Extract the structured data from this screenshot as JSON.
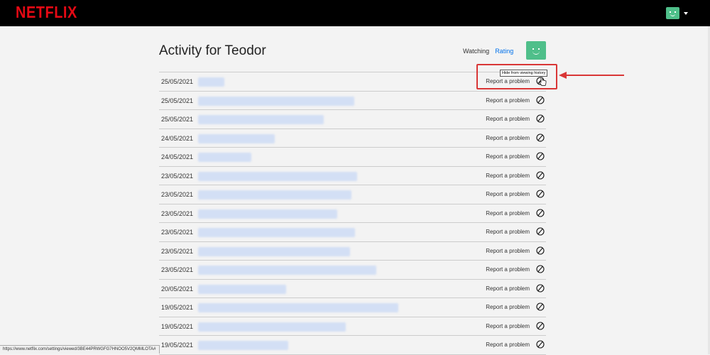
{
  "header": {
    "logo": "NETFLIX",
    "brand_color": "#e50914",
    "avatar_icon": "smiley-face-icon",
    "avatar_color": "#4fbf8a"
  },
  "page": {
    "title": "Activity for Teodor",
    "tabs": [
      {
        "label": "Watching",
        "active": true
      },
      {
        "label": "Rating",
        "active": false
      }
    ]
  },
  "tooltip": "Hide from viewing history",
  "report_label": "Report a problem",
  "rows": [
    {
      "date": "25/05/2021"
    },
    {
      "date": "25/05/2021"
    },
    {
      "date": "25/05/2021"
    },
    {
      "date": "24/05/2021"
    },
    {
      "date": "24/05/2021"
    },
    {
      "date": "23/05/2021"
    },
    {
      "date": "23/05/2021"
    },
    {
      "date": "23/05/2021"
    },
    {
      "date": "23/05/2021"
    },
    {
      "date": "23/05/2021"
    },
    {
      "date": "23/05/2021"
    },
    {
      "date": "20/05/2021"
    },
    {
      "date": "19/05/2021"
    },
    {
      "date": "19/05/2021"
    },
    {
      "date": "19/05/2021"
    }
  ],
  "status_bar": "https://www.netflix.com/settings/viewed/3BE44PRWGFG7HNOO5V2QMMLOTA#"
}
